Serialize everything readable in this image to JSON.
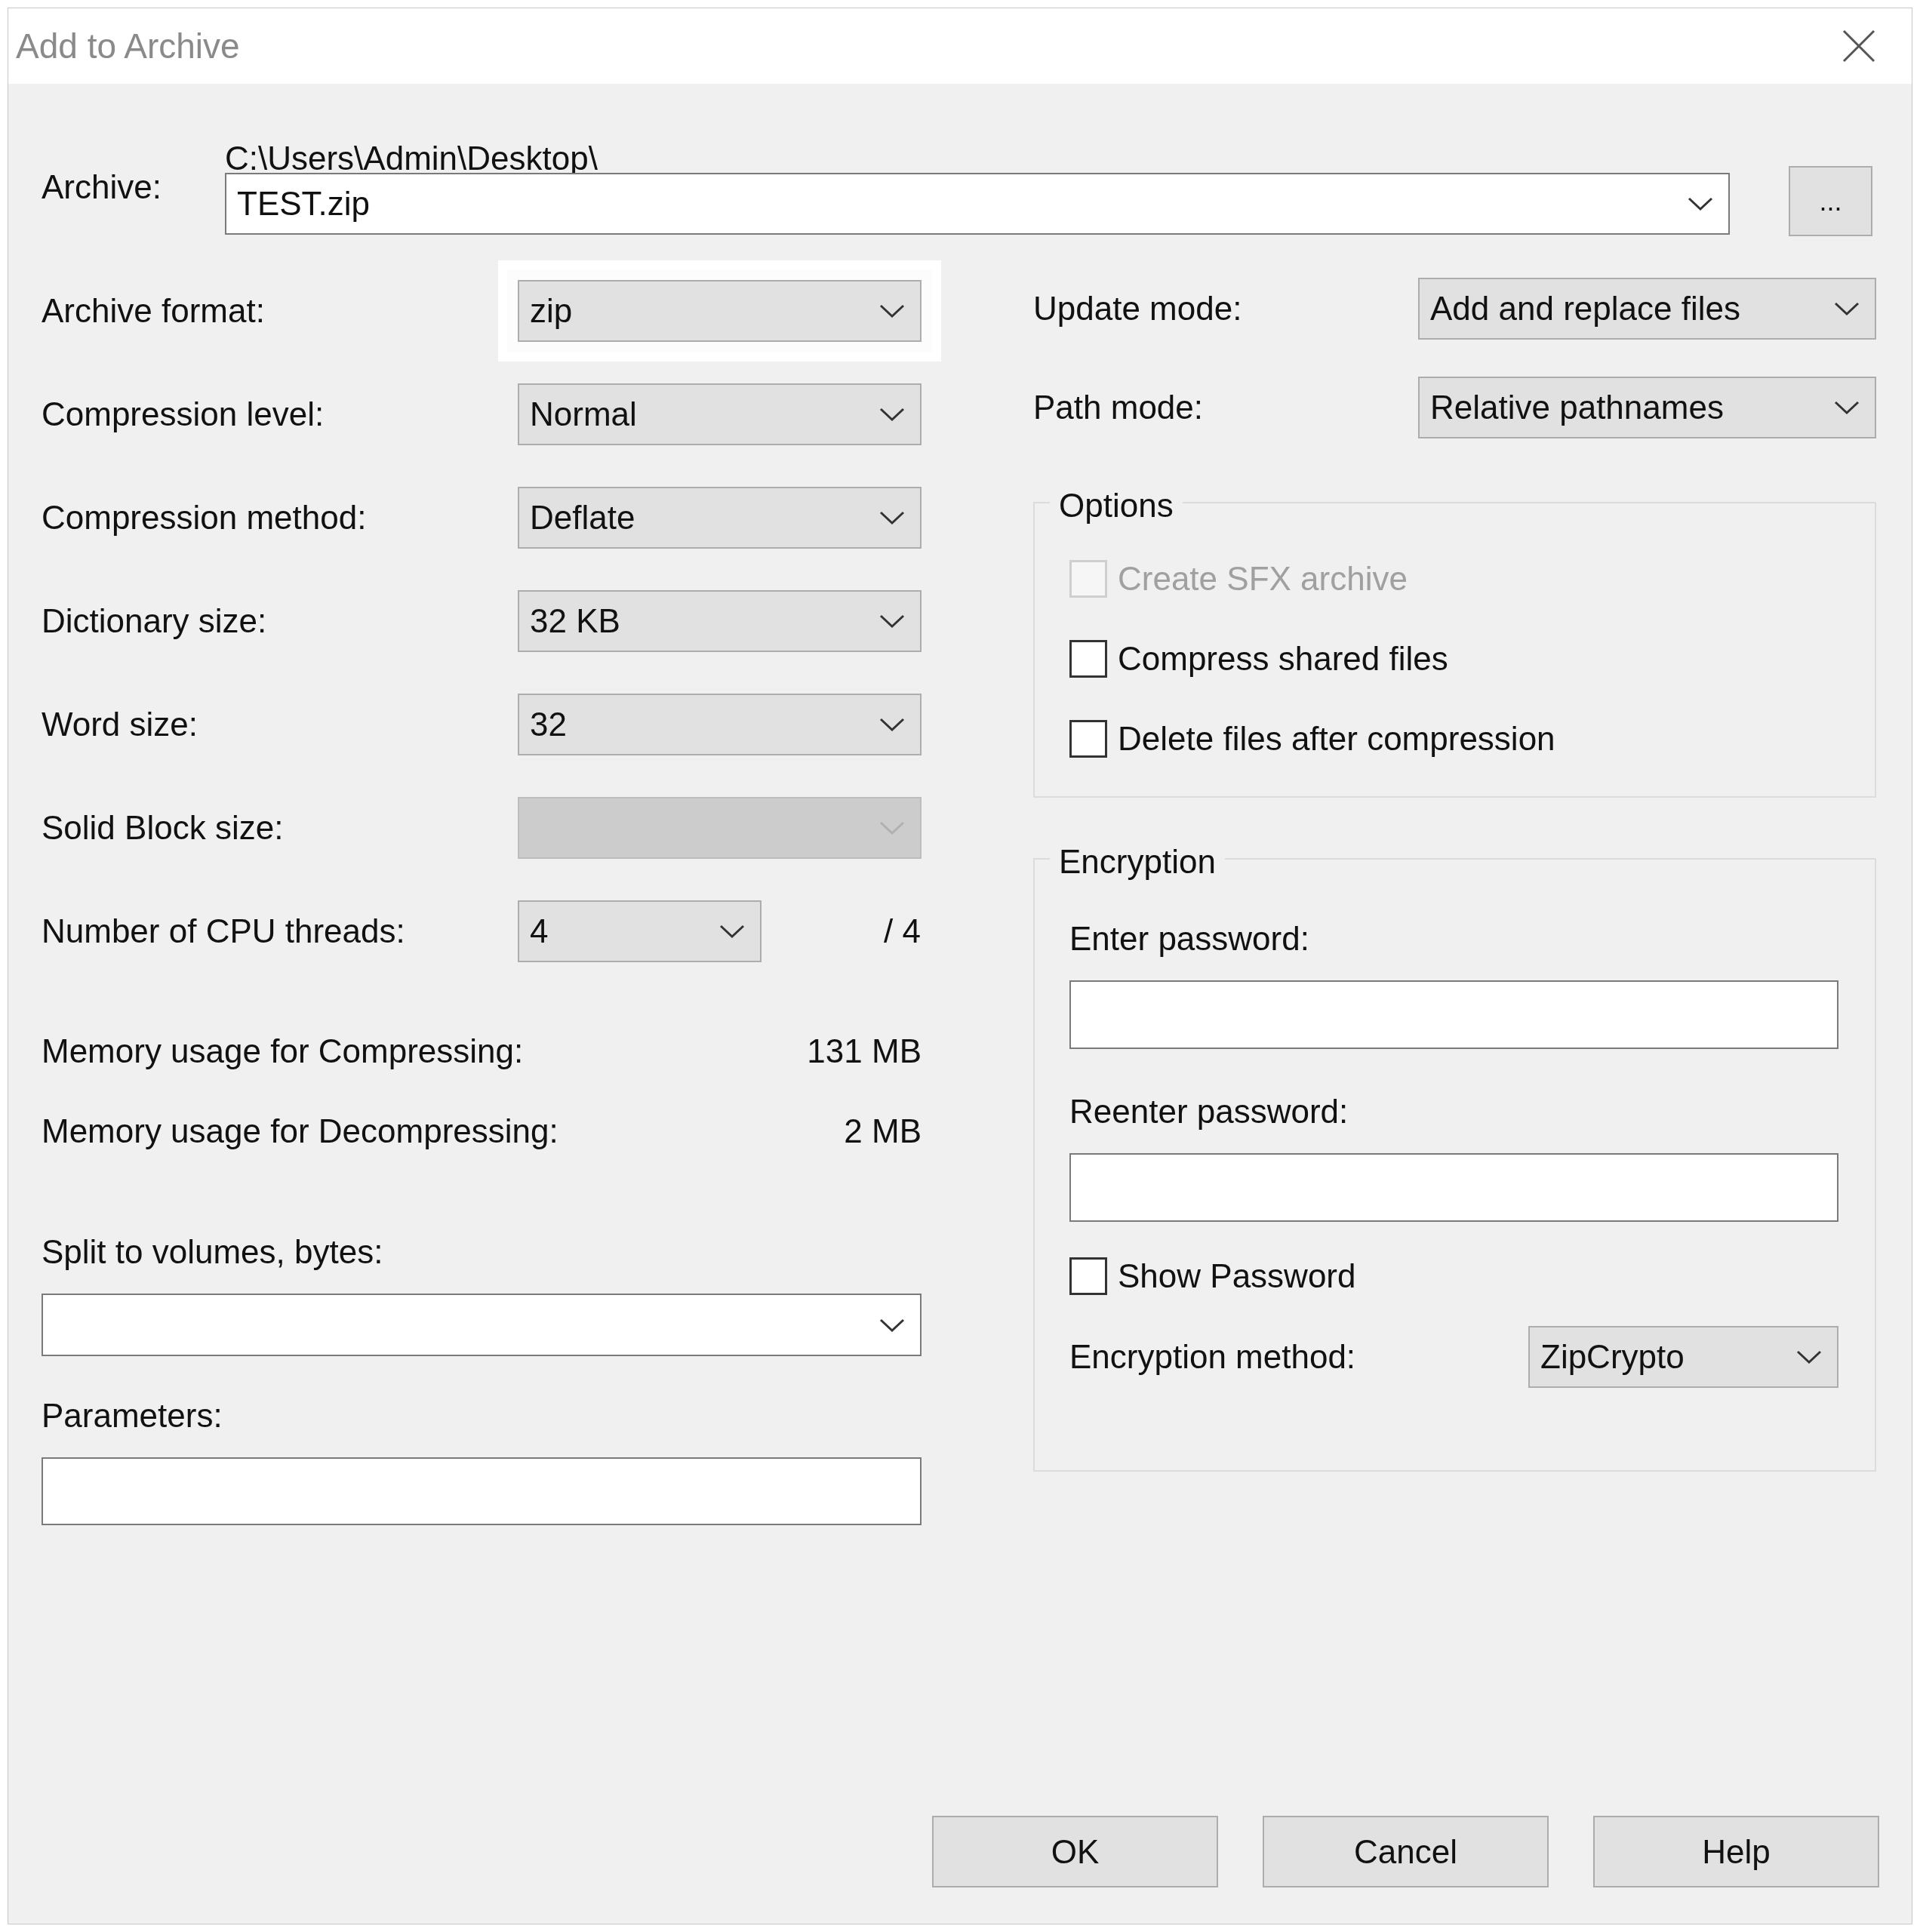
{
  "window": {
    "title": "Add to Archive"
  },
  "archive": {
    "label": "Archive:",
    "path": "C:\\Users\\Admin\\Desktop\\",
    "value": "TEST.zip",
    "browse": "..."
  },
  "left_fields": [
    {
      "kind": "combo",
      "label": "Archive format:",
      "value": "zip",
      "focused": true,
      "disabled": false
    },
    {
      "kind": "combo",
      "label": "Compression level:",
      "value": "Normal",
      "focused": false,
      "disabled": false
    },
    {
      "kind": "combo",
      "label": "Compression method:",
      "value": "Deflate",
      "focused": false,
      "disabled": false
    },
    {
      "kind": "combo",
      "label": "Dictionary size:",
      "value": "32 KB",
      "focused": false,
      "disabled": false
    },
    {
      "kind": "combo",
      "label": "Word size:",
      "value": "32",
      "focused": false,
      "disabled": false
    },
    {
      "kind": "combo",
      "label": "Solid Block size:",
      "focused": false,
      "disabled": true
    },
    {
      "kind": "narrow",
      "label": "Number of CPU threads:",
      "value": "4",
      "note": "/ 4",
      "focused": false,
      "disabled": false
    }
  ],
  "memory": [
    {
      "label": "Memory usage for Compressing:",
      "value": "131 MB"
    },
    {
      "label": "Memory usage for Decompressing:",
      "value": "2 MB"
    }
  ],
  "split": {
    "label": "Split to volumes, bytes:"
  },
  "parameters": {
    "label": "Parameters:"
  },
  "right_fields": [
    {
      "label": "Update mode:",
      "value": "Add and replace files"
    },
    {
      "label": "Path mode:",
      "value": "Relative pathnames"
    }
  ],
  "options": {
    "title": "Options",
    "checkboxes": [
      {
        "label": "Create SFX archive",
        "checked": false,
        "disabled": true
      },
      {
        "label": "Compress shared files",
        "checked": false,
        "disabled": false
      },
      {
        "label": "Delete files after compression",
        "checked": false,
        "disabled": false
      }
    ]
  },
  "encryption": {
    "title": "Encryption",
    "password_label": "Enter password:",
    "reenter_label": "Reenter password:",
    "show_password": {
      "label": "Show Password",
      "checked": false
    },
    "method": {
      "label": "Encryption method:",
      "value": "ZipCrypto"
    }
  },
  "buttons": [
    "OK",
    "Cancel",
    "Help"
  ]
}
